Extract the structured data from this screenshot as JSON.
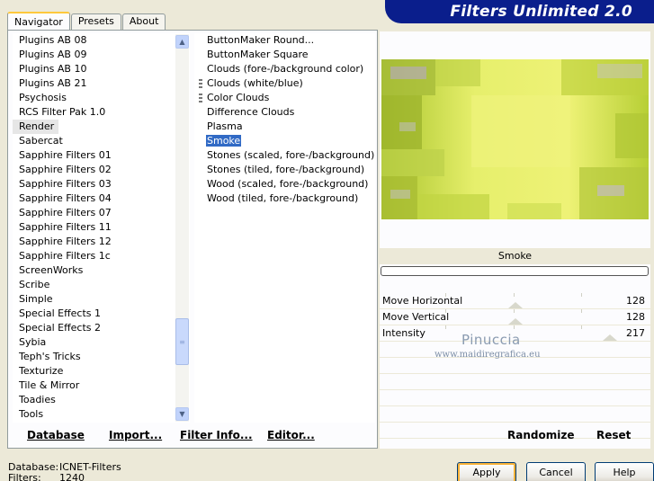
{
  "header": {
    "title": "Filters Unlimited 2.0"
  },
  "tabs": [
    {
      "label": "Navigator",
      "active": true
    },
    {
      "label": "Presets",
      "active": false
    },
    {
      "label": "About",
      "active": false
    }
  ],
  "categories": [
    "Plugins AB 08",
    "Plugins AB 09",
    "Plugins AB 10",
    "Plugins AB 21",
    "Psychosis",
    "RCS Filter Pak 1.0",
    "Render",
    "Sabercat",
    "Sapphire Filters 01",
    "Sapphire Filters 02",
    "Sapphire Filters 03",
    "Sapphire Filters 04",
    "Sapphire Filters 07",
    "Sapphire Filters 11",
    "Sapphire Filters 12",
    "Sapphire Filters 1c",
    "ScreenWorks",
    "Scribe",
    "Simple",
    "Special Effects 1",
    "Special Effects 2",
    "Sybia",
    "Teph's Tricks",
    "Texturize",
    "Tile & Mirror",
    "Toadies",
    "Tools"
  ],
  "selected_category": "Render",
  "filters": [
    {
      "label": "ButtonMaker Round...",
      "grip": false
    },
    {
      "label": "ButtonMaker Square",
      "grip": false
    },
    {
      "label": "Clouds (fore-/background color)",
      "grip": false
    },
    {
      "label": "Clouds (white/blue)",
      "grip": true
    },
    {
      "label": "Color Clouds",
      "grip": true
    },
    {
      "label": "Difference Clouds",
      "grip": false
    },
    {
      "label": "Plasma",
      "grip": false
    },
    {
      "label": "Smoke",
      "grip": false
    },
    {
      "label": "Stones (scaled, fore-/background)",
      "grip": false
    },
    {
      "label": "Stones (tiled, fore-/background)",
      "grip": false
    },
    {
      "label": "Wood (scaled, fore-/background)",
      "grip": false
    },
    {
      "label": "Wood (tiled, fore-/background)",
      "grip": false
    }
  ],
  "selected_filter": "Smoke",
  "left_buttons": {
    "database": "Database",
    "import": "Import...",
    "filter_info": "Filter Info...",
    "editor": "Editor..."
  },
  "preview": {
    "filter_name": "Smoke"
  },
  "params": [
    {
      "label": "Move Horizontal",
      "value": "128",
      "level": 0.5
    },
    {
      "label": "Move Vertical",
      "value": "128",
      "level": 0.5
    },
    {
      "label": "Intensity",
      "value": "217",
      "level": 0.85
    }
  ],
  "watermark": {
    "name": "Pinuccia",
    "url": "www.maidiregrafica.eu"
  },
  "right_buttons": {
    "randomize": "Randomize",
    "reset": "Reset"
  },
  "status": {
    "database_label": "Database:",
    "database_value": "ICNET-Filters",
    "filters_label": "Filters:",
    "filters_value": "1240"
  },
  "dialog_buttons": {
    "apply": "Apply",
    "cancel": "Cancel",
    "help": "Help"
  },
  "colors": {
    "banner": "#0a1e8c",
    "selection": "#316ac5",
    "preview_main": "#d8e84a"
  }
}
